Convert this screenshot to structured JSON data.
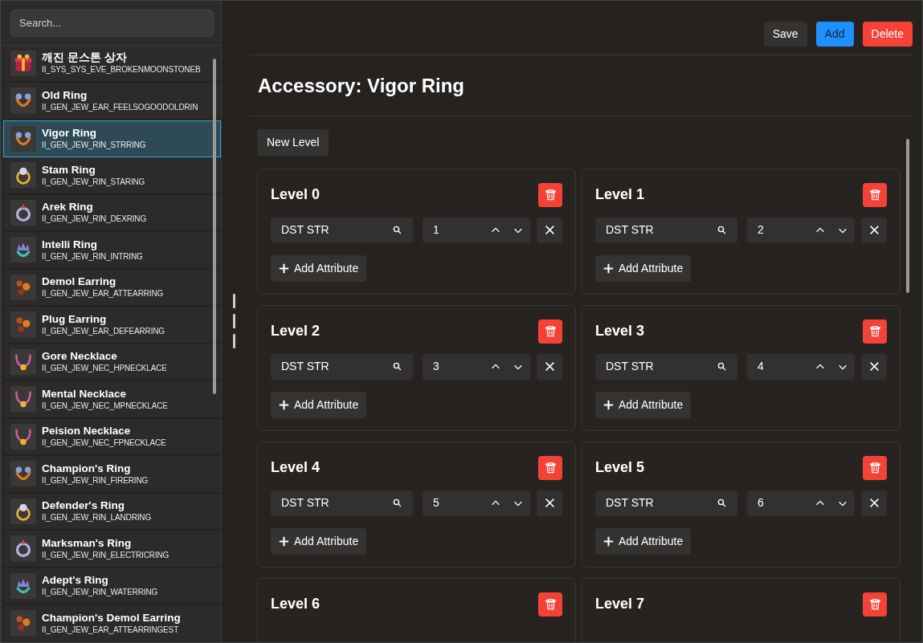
{
  "sidebar": {
    "search": {
      "placeholder": "Search..."
    },
    "items": [
      {
        "name": "깨진 문스톤 상자",
        "code": "II_SYS_SYS_EVE_BROKENMOONSTONEB",
        "kind": "box",
        "selected": false
      },
      {
        "name": "Old Ring",
        "code": "II_GEN_JEW_EAR_FEELSOGOODOLDRIN",
        "kind": "ring",
        "selected": false
      },
      {
        "name": "Vigor Ring",
        "code": "II_GEN_JEW_RIN_STRRING",
        "kind": "ring",
        "selected": true
      },
      {
        "name": "Stam Ring",
        "code": "II_GEN_JEW_RIN_STARING",
        "kind": "pearl-ring",
        "selected": false
      },
      {
        "name": "Arek Ring",
        "code": "II_GEN_JEW_RIN_DEXRING",
        "kind": "silver-ring",
        "selected": false
      },
      {
        "name": "Intelli Ring",
        "code": "II_GEN_JEW_RIN_INTRING",
        "kind": "crown-ring",
        "selected": false
      },
      {
        "name": "Demol Earring",
        "code": "II_GEN_JEW_EAR_ATTEARRING",
        "kind": "earring",
        "selected": false
      },
      {
        "name": "Plug Earring",
        "code": "II_GEN_JEW_EAR_DEFEARRING",
        "kind": "earring",
        "selected": false
      },
      {
        "name": "Gore Necklace",
        "code": "II_GEN_JEW_NEC_HPNECKLACE",
        "kind": "necklace",
        "selected": false
      },
      {
        "name": "Mental Necklace",
        "code": "II_GEN_JEW_NEC_MPNECKLACE",
        "kind": "necklace",
        "selected": false
      },
      {
        "name": "Peision Necklace",
        "code": "II_GEN_JEW_NEC_FPNECKLACE",
        "kind": "necklace",
        "selected": false
      },
      {
        "name": "Champion's Ring",
        "code": "II_GEN_JEW_RIN_FIRERING",
        "kind": "ring",
        "selected": false
      },
      {
        "name": "Defender's Ring",
        "code": "II_GEN_JEW_RIN_LANDRING",
        "kind": "pearl-ring",
        "selected": false
      },
      {
        "name": "Marksman's Ring",
        "code": "II_GEN_JEW_RIN_ELECTRICRING",
        "kind": "silver-ring",
        "selected": false
      },
      {
        "name": "Adept's Ring",
        "code": "II_GEN_JEW_RIN_WATERRING",
        "kind": "crown-ring",
        "selected": false
      },
      {
        "name": "Champion's Demol Earring",
        "code": "II_GEN_JEW_EAR_ATTEARRINGEST",
        "kind": "earring",
        "selected": false
      }
    ]
  },
  "toolbar": {
    "buttons": [
      {
        "label": "Save",
        "kind": "secondary"
      },
      {
        "label": "Add",
        "kind": "primary"
      },
      {
        "label": "Delete",
        "kind": "danger"
      }
    ]
  },
  "title": "Accessory: Vigor Ring",
  "new_level_button": "New Level",
  "levels": [
    {
      "title": "Level 0",
      "attributes": [
        {
          "name": "DST STR",
          "value": "1"
        }
      ],
      "add_button": "Add Attribute"
    },
    {
      "title": "Level 1",
      "attributes": [
        {
          "name": "DST STR",
          "value": "2"
        }
      ],
      "add_button": "Add Attribute"
    },
    {
      "title": "Level 2",
      "attributes": [
        {
          "name": "DST STR",
          "value": "3"
        }
      ],
      "add_button": "Add Attribute"
    },
    {
      "title": "Level 3",
      "attributes": [
        {
          "name": "DST STR",
          "value": "4"
        }
      ],
      "add_button": "Add Attribute"
    },
    {
      "title": "Level 4",
      "attributes": [
        {
          "name": "DST STR",
          "value": "5"
        }
      ],
      "add_button": "Add Attribute"
    },
    {
      "title": "Level 5",
      "attributes": [
        {
          "name": "DST STR",
          "value": "6"
        }
      ],
      "add_button": "Add Attribute"
    },
    {
      "title": "Level 6"
    },
    {
      "title": "Level 7"
    }
  ]
}
